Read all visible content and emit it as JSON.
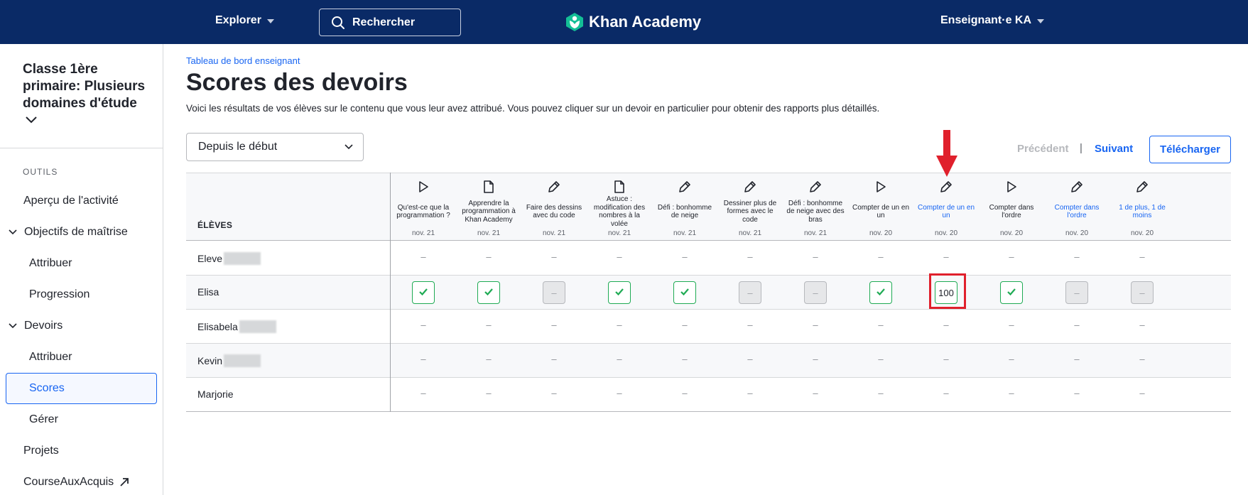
{
  "topbar": {
    "explorer_label": "Explorer",
    "search_label": "Rechercher",
    "brand": "Khan Academy",
    "user_label": "Enseignant·e KA"
  },
  "sidebar": {
    "class_title": "Classe 1ère primaire: Plusieurs domaines d'étude",
    "section_label": "OUTILS",
    "items": [
      {
        "label": "Aperçu de l'activité"
      },
      {
        "label": "Objectifs de maîtrise"
      },
      {
        "label": "Attribuer"
      },
      {
        "label": "Progression"
      },
      {
        "label": "Devoirs"
      },
      {
        "label": "Attribuer"
      },
      {
        "label": "Scores"
      },
      {
        "label": "Gérer"
      },
      {
        "label": "Projets"
      },
      {
        "label": "CourseAuxAcquis"
      }
    ]
  },
  "main": {
    "breadcrumb": "Tableau de bord enseignant",
    "title": "Scores des devoirs",
    "description": "Voici les résultats de vos élèves sur le contenu que vous leur avez attribué. Vous pouvez cliquer sur un devoir en particulier pour obtenir des rapports plus détaillés.",
    "date_filter": "Depuis le début",
    "prev_label": "Précédent",
    "separator": "|",
    "next_label": "Suivant",
    "download_label": "Télécharger"
  },
  "table": {
    "students_header": "ÉLÈVES",
    "columns": [
      {
        "name": "Qu'est-ce que la programmation ?",
        "date": "nov. 21",
        "icon": "play-icon",
        "link": false
      },
      {
        "name": "Apprendre la programmation à Khan Academy",
        "date": "nov. 21",
        "icon": "article-icon",
        "link": false
      },
      {
        "name": "Faire des dessins avec du code",
        "date": "nov. 21",
        "icon": "pencil-icon",
        "link": false
      },
      {
        "name": "Astuce : modification des nombres à la volée",
        "date": "nov. 21",
        "icon": "article-icon",
        "link": false
      },
      {
        "name": "Défi : bonhomme de neige",
        "date": "nov. 21",
        "icon": "pencil-icon",
        "link": false
      },
      {
        "name": "Dessiner plus de formes avec le code",
        "date": "nov. 21",
        "icon": "pencil-icon",
        "link": false
      },
      {
        "name": "Défi : bonhomme de neige avec des bras",
        "date": "nov. 21",
        "icon": "pencil-icon",
        "link": false
      },
      {
        "name": "Compter de un en un",
        "date": "nov. 20",
        "icon": "play-icon",
        "link": false
      },
      {
        "name": "Compter de un en un",
        "date": "nov. 20",
        "icon": "pencil-icon",
        "link": true
      },
      {
        "name": "Compter dans l'ordre",
        "date": "nov. 20",
        "icon": "play-icon",
        "link": false
      },
      {
        "name": "Compter dans l'ordre",
        "date": "nov. 20",
        "icon": "pencil-icon",
        "link": true
      },
      {
        "name": "1 de plus, 1 de moins",
        "date": "nov. 20",
        "icon": "pencil-icon",
        "link": true
      }
    ],
    "dash": "–",
    "rows": [
      {
        "name": "Eleve",
        "redacted": true,
        "cells": [
          "",
          "",
          "",
          "",
          "",
          "",
          "",
          "",
          "",
          "",
          "",
          ""
        ]
      },
      {
        "name": "Elisa",
        "redacted": false,
        "cells": [
          "check",
          "check",
          "na",
          "check",
          "check",
          "na",
          "na",
          "check",
          "100",
          "check",
          "na",
          "na"
        ]
      },
      {
        "name": "Elisabela",
        "redacted": true,
        "cells": [
          "",
          "",
          "",
          "",
          "",
          "",
          "",
          "",
          "",
          "",
          "",
          ""
        ]
      },
      {
        "name": "Kevin",
        "redacted": true,
        "cells": [
          "",
          "",
          "",
          "",
          "",
          "",
          "",
          "",
          "",
          "",
          "",
          ""
        ]
      },
      {
        "name": "Marjorie",
        "redacted": false,
        "cells": [
          "",
          "",
          "",
          "",
          "",
          "",
          "",
          "",
          "",
          "",
          "",
          ""
        ]
      }
    ]
  },
  "colors": {
    "topbar": "#0a2a66",
    "link": "#1865f2",
    "success": "#1fab54",
    "highlight": "#e0202c"
  }
}
